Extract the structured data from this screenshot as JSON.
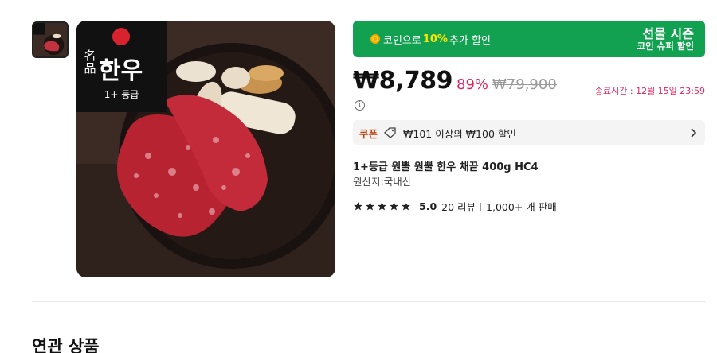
{
  "gallery": {
    "logo_text_1": "名品",
    "logo_text_2": "한우",
    "logo_grade": "1+ 등급"
  },
  "promo": {
    "prefix": "코인으로",
    "percent": "10%",
    "suffix": "추가 할인",
    "title": "선물 시즌",
    "subtitle": "코인 슈퍼 할인"
  },
  "price": {
    "current": "₩8,789",
    "discount": "89%",
    "original": "₩79,900",
    "deadline": "종료시간 : 12월 15일 23:59"
  },
  "coupon": {
    "label": "쿠폰",
    "text": "₩101 이상의 ₩100 할인"
  },
  "product": {
    "title": "1+등급 원뿔 원뿔 한우 채끝 400g HC4",
    "origin": "원산지:국내산"
  },
  "rating": {
    "stars": 5,
    "score": "5.0",
    "reviews": "20 리뷰",
    "sold": "1,000+ 개 판매"
  },
  "related": {
    "title": "연관 상품"
  },
  "colors": {
    "promo_bg": "#12a150",
    "accent_red": "#e0245e",
    "coupon_label": "#c2410c"
  }
}
